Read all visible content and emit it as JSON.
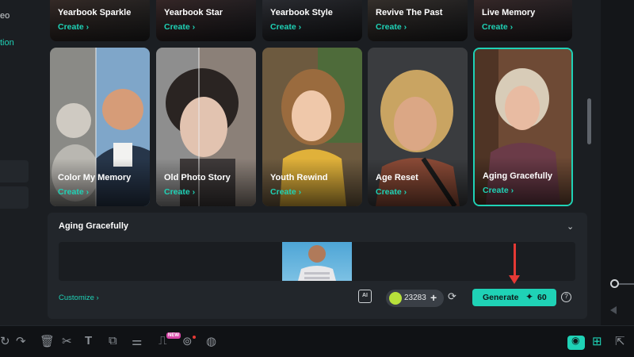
{
  "colors": {
    "accent": "#1fd2b6",
    "panel": "#1b1e22",
    "annotation_arrow": "#e53935"
  },
  "sidebar": {
    "items": [
      {
        "label": "eo"
      },
      {
        "label": "tion",
        "active": true
      }
    ]
  },
  "templates": {
    "row1": [
      {
        "title": "Yearbook Sparkle",
        "cta": "Create"
      },
      {
        "title": "Yearbook Star",
        "cta": "Create"
      },
      {
        "title": "Yearbook Style",
        "cta": "Create"
      },
      {
        "title": "Revive The Past",
        "cta": "Create"
      },
      {
        "title": "Live Memory",
        "cta": "Create"
      }
    ],
    "row2": [
      {
        "title": "Color My Memory",
        "cta": "Create"
      },
      {
        "title": "Old Photo Story",
        "cta": "Create"
      },
      {
        "title": "Youth Rewind",
        "cta": "Create"
      },
      {
        "title": "Age Reset",
        "cta": "Create"
      },
      {
        "title": "Aging Gracefully",
        "cta": "Create",
        "selected": true
      }
    ]
  },
  "detail": {
    "title": "Aging Gracefully",
    "customize": "Customize",
    "ai_icon_label": "AI",
    "credits": "23283",
    "generate": {
      "label": "Generate",
      "cost": "60"
    },
    "help": "?"
  },
  "toolbar": {
    "new_badge": "NEW",
    "icons": [
      "redo-icon",
      "delete-icon",
      "cut-icon",
      "text-icon",
      "crop-icon",
      "adjust-icon",
      "ai-text-icon",
      "ai-face-icon",
      "ai-portrait-icon",
      "mask-icon",
      "split-icon",
      "export-icon"
    ]
  }
}
